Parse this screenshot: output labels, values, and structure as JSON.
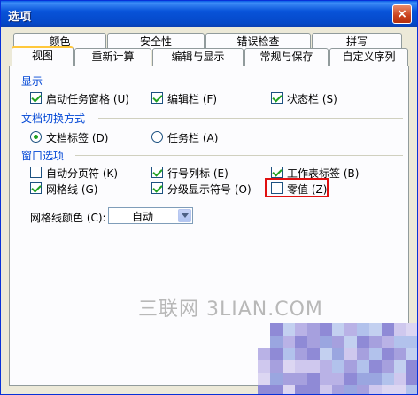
{
  "window": {
    "title": "选项",
    "close_glyph": "×"
  },
  "tabs_back": [
    "颜色",
    "安全性",
    "错误检查",
    "拼写"
  ],
  "tabs_front": [
    "视图",
    "重新计算",
    "编辑与显示",
    "常规与保存",
    "自定义序列"
  ],
  "active_tab": "视图",
  "groups": {
    "display": {
      "title": "显示",
      "items": [
        {
          "label": "启动任务窗格 (U)",
          "checked": true
        },
        {
          "label": "编辑栏 (F)",
          "checked": true
        },
        {
          "label": "状态栏 (S)",
          "checked": true
        }
      ]
    },
    "doc_switch": {
      "title": "文档切换方式",
      "items": [
        {
          "label": "文档标签 (D)",
          "selected": true
        },
        {
          "label": "任务栏 (A)",
          "selected": false
        }
      ]
    },
    "window_options": {
      "title": "窗口选项",
      "items": [
        {
          "label": "自动分页符 (K)",
          "checked": false
        },
        {
          "label": "行号列标 (E)",
          "checked": true
        },
        {
          "label": "工作表标签 (B)",
          "checked": true
        },
        {
          "label": "网格线 (G)",
          "checked": true
        },
        {
          "label": "分级显示符号 (O)",
          "checked": true
        },
        {
          "label": "零值 (Z)",
          "checked": false
        }
      ]
    }
  },
  "gridline_color": {
    "label": "网格线颜色 (C):",
    "value": "自动"
  },
  "watermark": "三联网 3LIAN.COM",
  "colors": {
    "highlight": "#e01010",
    "group_title": "#0046d5",
    "check": "#21a121"
  }
}
